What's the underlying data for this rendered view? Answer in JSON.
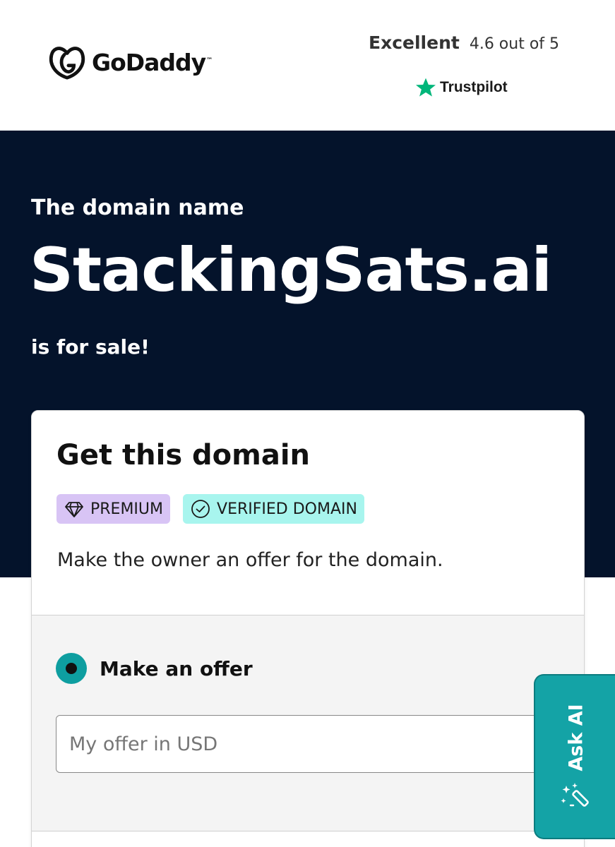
{
  "header": {
    "brand": "GoDaddy",
    "brand_tm": "™",
    "rating_word": "Excellent",
    "rating_score": "4.6 out of 5",
    "trustpilot_label": "Trustpilot"
  },
  "hero": {
    "intro": "The domain name",
    "domain": "StackingSats.ai",
    "outro": "is for sale!"
  },
  "card": {
    "title": "Get this domain",
    "badges": [
      {
        "label": "PREMIUM",
        "icon": "diamond-icon",
        "color": "#d8c4f5"
      },
      {
        "label": "VERIFIED DOMAIN",
        "icon": "check-circle-icon",
        "color": "#a8f5ee"
      }
    ],
    "subtitle": "Make the owner an offer for the domain.",
    "offer": {
      "option_label": "Make an offer",
      "selected": true,
      "input_placeholder": "My offer in USD",
      "input_value": ""
    }
  },
  "ask_ai": {
    "label": "Ask AI",
    "icon": "magic-wand-icon"
  },
  "colors": {
    "hero_bg": "#04132b",
    "accent_teal": "#14a3a6",
    "trustpilot_green": "#00b67a"
  }
}
